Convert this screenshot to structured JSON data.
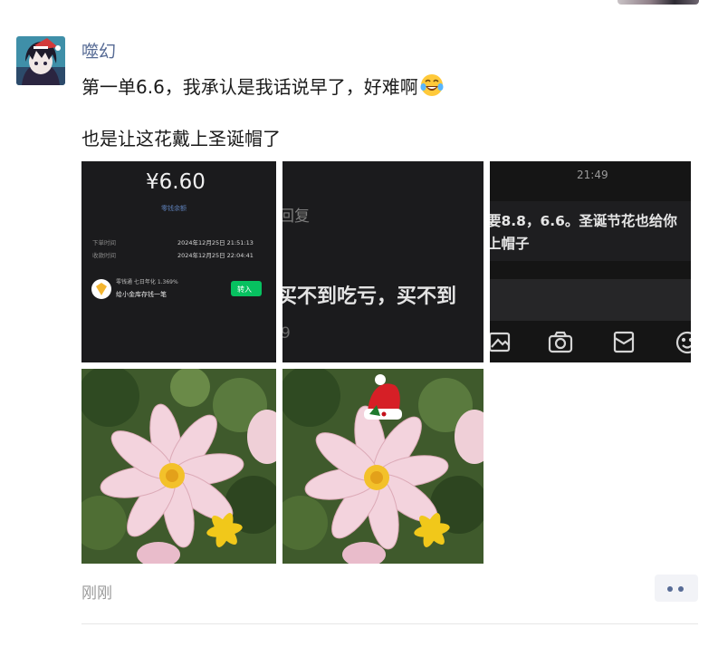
{
  "post": {
    "author": "噬幻",
    "text_line1": "第一单6.6，我承认是我话说早了，好难啊",
    "text_line2": "也是让这花戴上圣诞帽了",
    "timestamp": "刚刚"
  },
  "images": {
    "shot1": {
      "amount": "¥6.60",
      "sub_label": "零钱余额",
      "row1_label": "下单时间",
      "row1_value": "2024年12月25日 21:51:13",
      "row2_label": "收款时间",
      "row2_value": "2024年12月25日 22:04:41",
      "promo_line1": "零钱通 七日年化 1.369%",
      "promo_line2": "给小金库存钱一笔",
      "promo_button": "转入"
    },
    "shot2": {
      "reply_label": "回复",
      "main_text": "买不到吃亏，买不到",
      "corner_digit": "9"
    },
    "shot3": {
      "clock": "21:49",
      "msg_line1": "要8.8，6.6。圣诞节花也给你",
      "msg_line2": "上帽子"
    },
    "flower1": {
      "icon": "flower-photo"
    },
    "flower2": {
      "icon": "flower-with-santa-hat-photo"
    }
  },
  "colors": {
    "name_link": "#576b95",
    "timestamp": "#9a9a9a",
    "accent_green": "#07c160"
  }
}
